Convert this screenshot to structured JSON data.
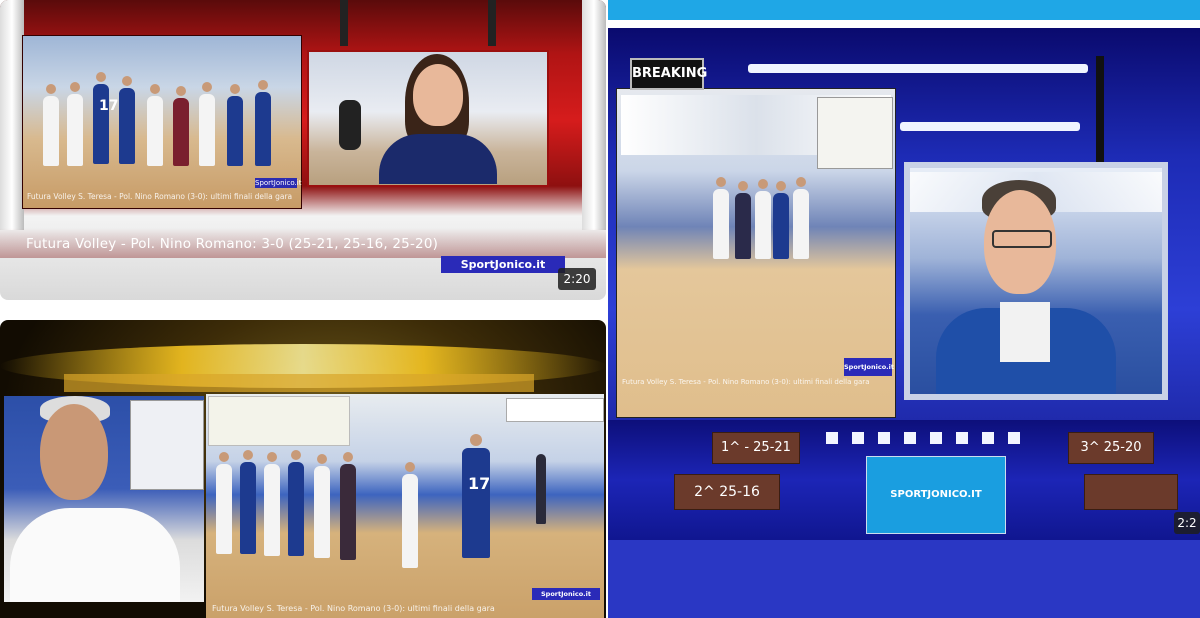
{
  "panels": {
    "top_left": {
      "score_line": "Futura Volley - Pol. Nino Romano: 3-0 (25-21, 25-16, 25-20)",
      "site_badge": "SportJonico.it",
      "duration": "2:20",
      "caption": "Futura Volley S. Teresa - Pol. Nino Romano (3-0): ultimi finali della gara",
      "small_badge": "SportJonico.it"
    },
    "top_right": {
      "breaking_label": "BREAKING",
      "caption": "Futura Volley S. Teresa - Pol. Nino Romano (3-0): ultimi finali della gara",
      "small_badge": "SportJonico.it",
      "set1": "1^ - 25-21",
      "set2": "2^ 25-16",
      "set3": "3^ 25-20",
      "logo_text": "SPORTJONICO.IT",
      "duration": "2:2"
    },
    "bottom_left": {
      "caption": "Futura Volley S. Teresa - Pol. Nino Romano (3-0): ultimi finali della gara",
      "small_badge": "SportJonico.it"
    }
  },
  "colors": {
    "top_bar": "#1fa7e6",
    "badge_blue": "#2a2ab8",
    "studio_red": "#d61c1c",
    "studio_blue": "#1d2bb5"
  }
}
